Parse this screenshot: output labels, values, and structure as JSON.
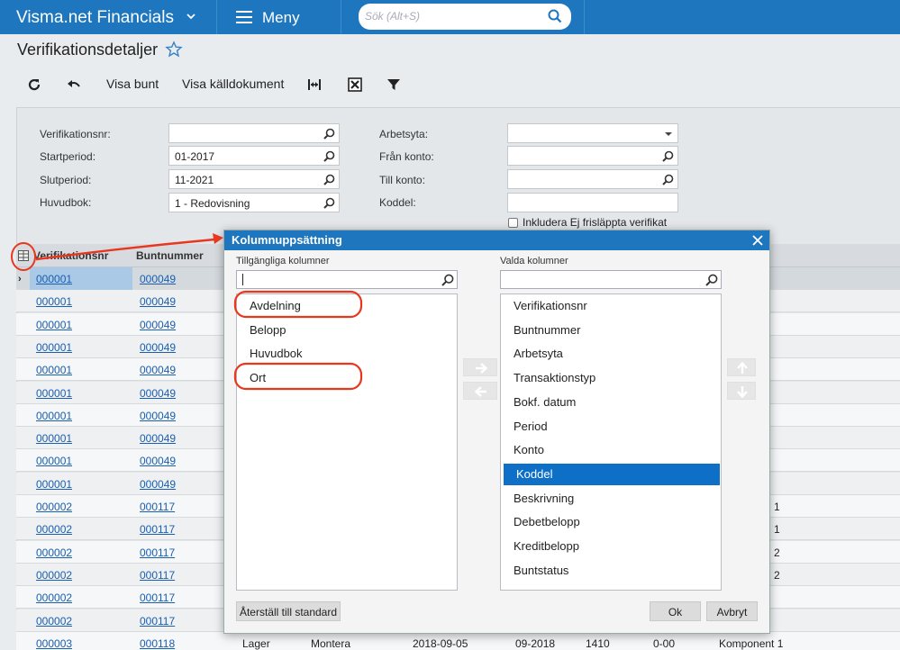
{
  "topbar": {
    "brand": "Visma.net Financials",
    "menu_label": "Meny",
    "search_placeholder": "Sök (Alt+S)"
  },
  "page": {
    "title": "Verifikationsdetaljer"
  },
  "toolbar": {
    "visa_bunt": "Visa bunt",
    "visa_kalldokument": "Visa källdokument"
  },
  "form": {
    "verifikationsnr": {
      "label": "Verifikationsnr:",
      "value": ""
    },
    "startperiod": {
      "label": "Startperiod:",
      "value": "01-2017"
    },
    "slutperiod": {
      "label": "Slutperiod:",
      "value": "11-2021"
    },
    "huvudbok": {
      "label": "Huvudbok:",
      "value": "1 - Redovisning"
    },
    "arbetsyta": {
      "label": "Arbetsyta:",
      "value": ""
    },
    "fran_konto": {
      "label": "Från konto:",
      "value": ""
    },
    "till_konto": {
      "label": "Till konto:",
      "value": ""
    },
    "koddel": {
      "label": "Koddel:",
      "value": ""
    },
    "inkludera_label": "Inkludera Ej frisläppta verifikat"
  },
  "grid": {
    "headers": {
      "verifikationsnr": "Verifikationsnr",
      "buntnummer": "Buntnummer"
    },
    "rows": [
      {
        "v": "000001",
        "b": "000049",
        "extra": []
      },
      {
        "v": "000001",
        "b": "000049",
        "extra": []
      },
      {
        "v": "000001",
        "b": "000049",
        "extra": []
      },
      {
        "v": "000001",
        "b": "000049",
        "extra": []
      },
      {
        "v": "000001",
        "b": "000049",
        "extra": []
      },
      {
        "v": "000001",
        "b": "000049",
        "extra": []
      },
      {
        "v": "000001",
        "b": "000049",
        "extra": []
      },
      {
        "v": "000001",
        "b": "000049",
        "extra": []
      },
      {
        "v": "000001",
        "b": "000049",
        "extra": []
      },
      {
        "v": "000001",
        "b": "000049",
        "extra": []
      },
      {
        "v": "000002",
        "b": "000117",
        "tail": "1"
      },
      {
        "v": "000002",
        "b": "000117",
        "tail": "1"
      },
      {
        "v": "000002",
        "b": "000117",
        "tail": "2"
      },
      {
        "v": "000002",
        "b": "000117",
        "tail": "2"
      },
      {
        "v": "000002",
        "b": "000117",
        "tail": ""
      },
      {
        "v": "000002",
        "b": "000117",
        "tail": ""
      },
      {
        "v": "000003",
        "b": "000118",
        "arbetsyta": "Lager",
        "transtyp": "Montera",
        "datum": "2018-09-05",
        "period": "09-2018",
        "konto": "1410",
        "koddel": "0-00",
        "beskr": "Komponent 1"
      }
    ]
  },
  "dialog": {
    "title": "Kolumnuppsättning",
    "available_label": "Tillgängliga kolumner",
    "selected_label": "Valda kolumner",
    "available": [
      "Avdelning",
      "Belopp",
      "Huvudbok",
      "Ort"
    ],
    "selected": [
      "Verifikationsnr",
      "Buntnummer",
      "Arbetsyta",
      "Transaktionstyp",
      "Bokf. datum",
      "Period",
      "Konto",
      "Koddel",
      "Beskrivning",
      "Debetbelopp",
      "Kreditbelopp",
      "Buntstatus"
    ],
    "selected_active": "Koddel",
    "reset_label": "Återställ till standard",
    "ok_label": "Ok",
    "cancel_label": "Avbryt"
  },
  "colors": {
    "brand": "#1d76be",
    "link": "#1a5fb0",
    "highlight": "#0e6fc6",
    "annotation": "#e8371f"
  }
}
